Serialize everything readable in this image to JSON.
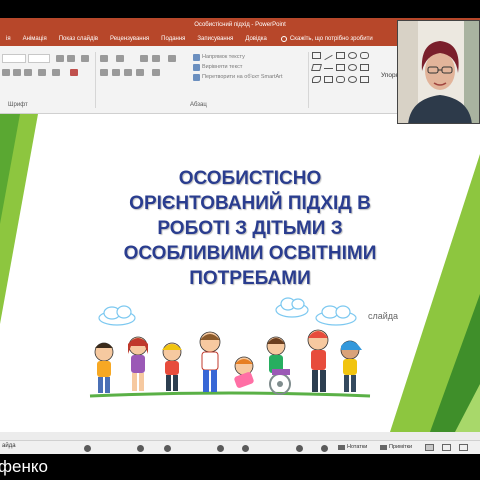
{
  "window": {
    "title": "Особистісний підхід  -  PowerPoint"
  },
  "ribbon": {
    "tabs": [
      "ія",
      "Анімація",
      "Показ слайдів",
      "Рецензування",
      "Подання",
      "Записування",
      "Довідка"
    ],
    "tell_me": "Скажіть, що потрібно зробити",
    "font_group_label": "Шрифт",
    "paragraph_group_label": "Абзац",
    "text_direction": "Напрямок тексту",
    "align_text": "Вирівняти текст",
    "convert_smartart": "Перетворити на об'єкт SmartArt",
    "arrange_label": "Упоря"
  },
  "slide": {
    "title_lines": [
      "ОСОБИСТІСНО",
      "ОРІЄНТОВАНИЙ ПІДХІД В",
      "РОБОТІ З ДІТЬМИ З",
      "ОСОБЛИВИМИ ОСВІТНІМИ",
      "ПОТРЕБАМИ"
    ],
    "side_text": "слайда",
    "colors": {
      "title": "#2a3d8f",
      "green_light": "#8dc63f",
      "green_dark": "#3f8f2a"
    }
  },
  "statusbar": {
    "left_text": "айда",
    "notes_label": "Нотатки",
    "comments_label": "Примітки"
  },
  "participant": {
    "name": "фенко"
  },
  "icons": {
    "lightbulb": "lightbulb-icon",
    "notes": "notes-icon",
    "comments": "comments-icon"
  }
}
